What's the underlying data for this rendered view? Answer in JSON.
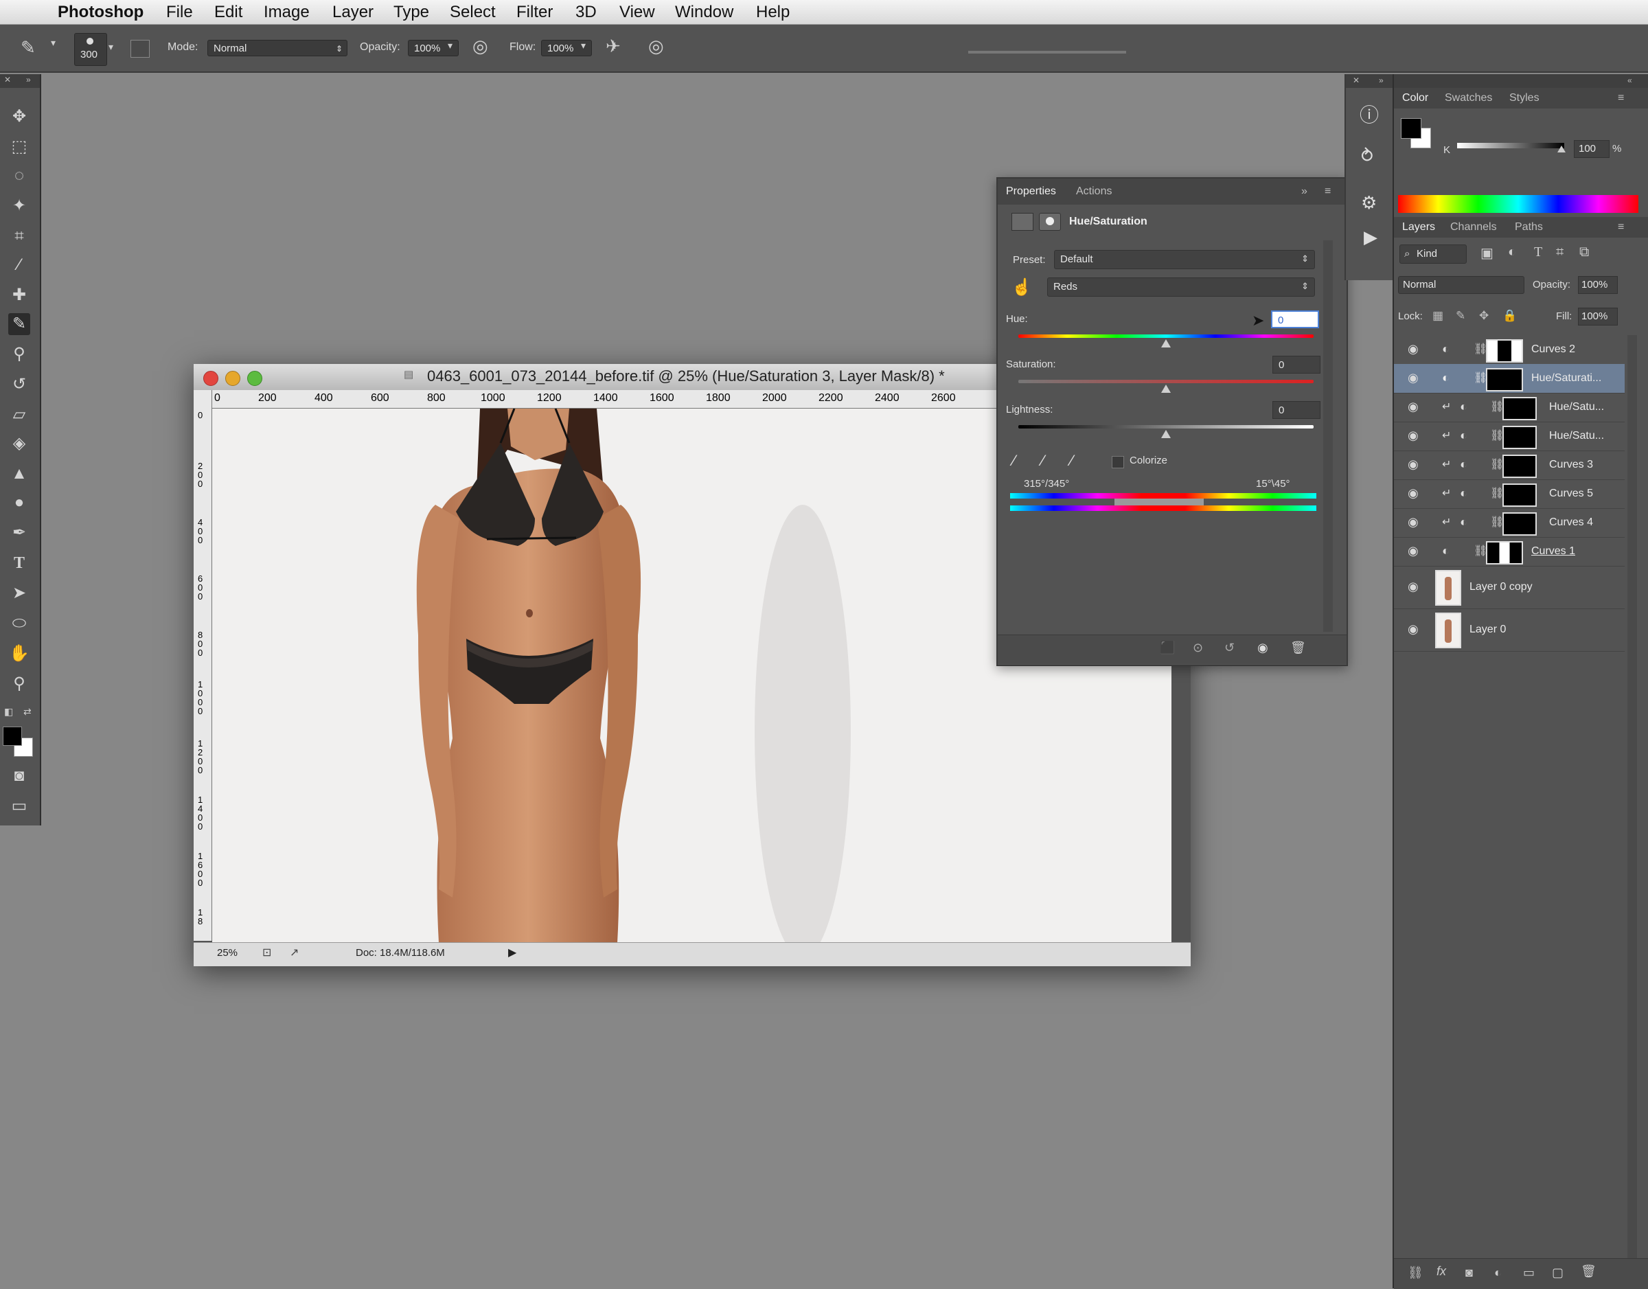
{
  "menubar": {
    "apple": "",
    "app": "Photoshop",
    "items": [
      "File",
      "Edit",
      "Image",
      "Layer",
      "Type",
      "Select",
      "Filter",
      "3D",
      "View",
      "Window",
      "Help"
    ]
  },
  "options": {
    "brush_size": "300",
    "mode_label": "Mode:",
    "mode_value": "Normal",
    "opacity_label": "Opacity:",
    "opacity_value": "100%",
    "flow_label": "Flow:",
    "flow_value": "100%"
  },
  "document": {
    "title": "0463_6001_073_20144_before.tif @ 25% (Hue/Saturation 3, Layer Mask/8) *",
    "ruler_top": [
      "0",
      "200",
      "400",
      "600",
      "800",
      "1000",
      "1200",
      "1400",
      "1600",
      "1800",
      "2000",
      "2200",
      "2400",
      "2600"
    ],
    "ruler_left": [
      "0",
      "2\n0\n0",
      "4\n0\n0",
      "6\n0\n0",
      "8\n0\n0",
      "1\n0\n0\n0",
      "1\n2\n0\n0",
      "1\n4\n0\n0",
      "1\n6\n0\n0",
      "1\n8"
    ],
    "zoom": "25%",
    "doc_size": "Doc: 18.4M/118.6M"
  },
  "properties": {
    "tab_properties": "Properties",
    "tab_actions": "Actions",
    "adjustment_title": "Hue/Saturation",
    "preset_label": "Preset:",
    "preset_value": "Default",
    "channel_value": "Reds",
    "hue_label": "Hue:",
    "hue_value": "0",
    "saturation_label": "Saturation:",
    "saturation_value": "0",
    "lightness_label": "Lightness:",
    "lightness_value": "0",
    "colorize_label": "Colorize",
    "range_left": "315°/345°",
    "range_right": "15°\\45°"
  },
  "color_panel": {
    "tabs": [
      "Color",
      "Swatches",
      "Styles"
    ],
    "channel": "K",
    "value": "100",
    "unit": "%"
  },
  "layers_panel": {
    "tabs": [
      "Layers",
      "Channels",
      "Paths"
    ],
    "filter_kind": "Kind",
    "blend_mode": "Normal",
    "opacity_label": "Opacity:",
    "opacity_value": "100%",
    "lock_label": "Lock:",
    "fill_label": "Fill:",
    "fill_value": "100%",
    "layers": [
      {
        "name": "Curves 2"
      },
      {
        "name": "Hue/Saturati..."
      },
      {
        "name": "Hue/Satu..."
      },
      {
        "name": "Hue/Satu..."
      },
      {
        "name": "Curves 3"
      },
      {
        "name": "Curves 5"
      },
      {
        "name": "Curves 4"
      },
      {
        "name": "Curves 1"
      },
      {
        "name": "Layer 0 copy"
      },
      {
        "name": "Layer 0"
      }
    ]
  }
}
